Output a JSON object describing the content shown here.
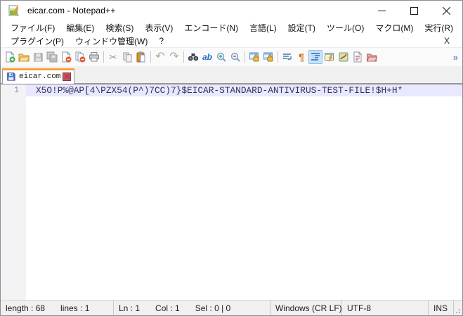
{
  "window": {
    "title": "eicar.com - Notepad++"
  },
  "menu": {
    "row1": [
      "ファイル(F)",
      "編集(E)",
      "検索(S)",
      "表示(V)",
      "エンコード(N)",
      "言語(L)",
      "設定(T)",
      "ツール(O)",
      "マクロ(M)",
      "実行(R)"
    ],
    "row2": [
      "プラグイン(P)",
      "ウィンドウ管理(W)",
      "?"
    ],
    "close_label": "X"
  },
  "toolbar": {
    "icons": [
      "new-file",
      "open-file",
      "save-disabled",
      "save-all-disabled",
      "close-file",
      "close-all-files",
      "print",
      "cut-disabled",
      "copy-disabled",
      "paste",
      "undo-disabled",
      "redo-disabled",
      "find",
      "replace",
      "zoom-in",
      "zoom-out",
      "sync-vertical-scroll",
      "sync-horizontal-scroll",
      "word-wrap",
      "show-all-characters",
      "show-indent-guide-pressed",
      "user-defined-dialog",
      "document-map",
      "function-list",
      "folder-as-workspace"
    ],
    "cut_glyph": "✂",
    "undo_glyph": "↶",
    "redo_glyph": "↷",
    "pilcrow_glyph": "¶",
    "replace_glyph": "ab",
    "overflow_glyph": "»"
  },
  "tabs": [
    {
      "label": "eicar.com",
      "active": true
    }
  ],
  "editor": {
    "line_number": "1",
    "line_text": "X5O!P%@AP[4\\PZX54(P^)7CC)7}$EICAR-STANDARD-ANTIVIRUS-TEST-FILE!$H+H*"
  },
  "status_bar": {
    "length": "length : 68",
    "lines": "lines : 1",
    "ln": "Ln : 1",
    "col": "Col : 1",
    "sel": "Sel : 0 | 0",
    "eol": "Windows (CR LF)",
    "encoding": "UTF-8",
    "mode": "INS"
  },
  "colors": {
    "tab_accent_orange": "#f9a13a",
    "current_line_highlight": "#e8e8ff",
    "pressed_icon_background": "#cbe3f7",
    "tab_close_background": "#b25b6b",
    "editor_text": "#32325a"
  }
}
